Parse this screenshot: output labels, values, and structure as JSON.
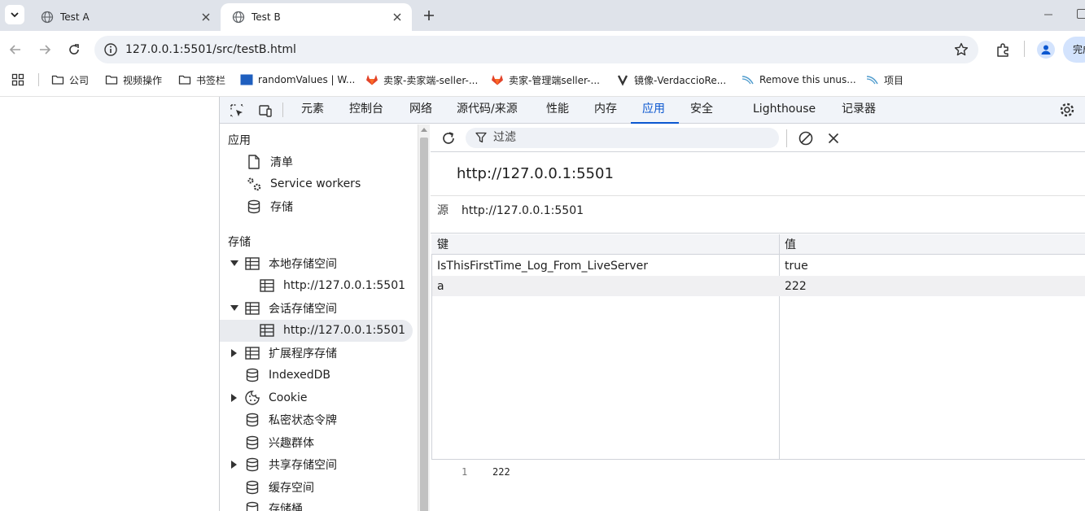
{
  "tabs": [
    {
      "title": "Test A"
    },
    {
      "title": "Test B"
    }
  ],
  "omnibox": {
    "url": "127.0.0.1:5501/src/testB.html"
  },
  "profile_chip": "完成",
  "bookmarks": [
    {
      "label": "公司",
      "icon": "folder-icon"
    },
    {
      "label": "视频操作",
      "icon": "folder-icon"
    },
    {
      "label": "书签栏",
      "icon": "folder-icon"
    },
    {
      "label": "randomValues | W...",
      "icon": "eb-logo-icon"
    },
    {
      "label": "卖家-卖家端-seller-...",
      "icon": "gitlab-icon"
    },
    {
      "label": "卖家-管理端seller-...",
      "icon": "gitlab-icon"
    },
    {
      "label": "镜像-VerdaccioRe...",
      "icon": "verdaccio-icon"
    },
    {
      "label": "Remove this unus...",
      "icon": "sonar-icon"
    },
    {
      "label": "项目",
      "icon": "sonar-icon"
    }
  ],
  "devtools": {
    "tabs": [
      "元素",
      "控制台",
      "网络",
      "源代码/来源",
      "性能",
      "内存",
      "应用",
      "安全",
      "Lighthouse",
      "记录器"
    ],
    "active_tab": "应用",
    "sidebar": {
      "app_section": "应用",
      "app_items": [
        "清单",
        "Service workers",
        "存储"
      ],
      "storage_section": "存储",
      "storage_items": [
        {
          "label": "本地存储空间",
          "expanded": true
        },
        {
          "label": "http://127.0.0.1:5501"
        },
        {
          "label": "会话存储空间",
          "expanded": true
        },
        {
          "label": "http://127.0.0.1:5501",
          "selected": true
        },
        {
          "label": "扩展程序存储",
          "expanded": false
        },
        {
          "label": "IndexedDB"
        },
        {
          "label": "Cookie",
          "expanded": false
        },
        {
          "label": "私密状态令牌"
        },
        {
          "label": "兴趣群体"
        },
        {
          "label": "共享存储空间",
          "expanded": false
        },
        {
          "label": "缓存空间"
        },
        {
          "label": "存储桶"
        }
      ]
    },
    "filter_placeholder": "过滤",
    "origin_title": "http://127.0.0.1:5501",
    "origin_label": "源",
    "origin_value": "http://127.0.0.1:5501",
    "table": {
      "headers": [
        "键",
        "值"
      ],
      "rows": [
        [
          "IsThisFirstTime_Log_From_LiveServer",
          "true"
        ],
        [
          "a",
          "222"
        ]
      ]
    },
    "preview": {
      "line": "1",
      "text": "222"
    }
  }
}
